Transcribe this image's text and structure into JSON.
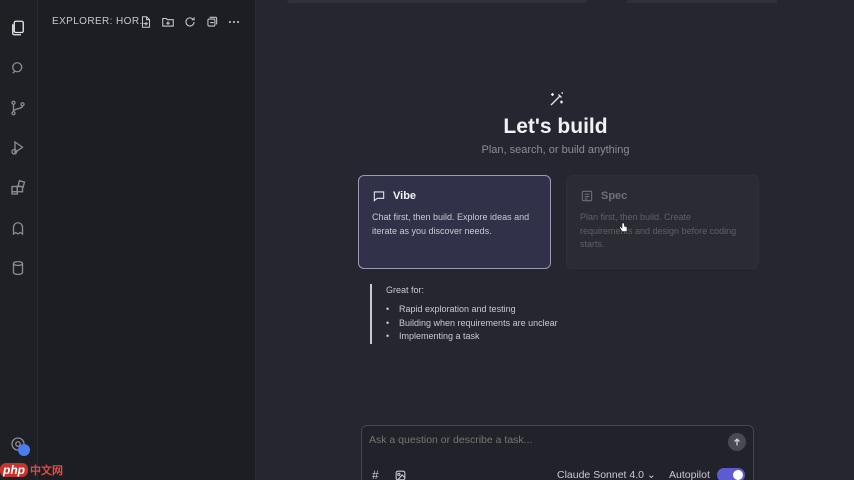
{
  "explorer": {
    "title": "EXPLORER: HOR..."
  },
  "main": {
    "heading": "Let's build",
    "subheading": "Plan, search, or build anything",
    "cards": [
      {
        "title": "Vibe",
        "description": "Chat first, then build. Explore ideas and iterate as you discover needs.",
        "icon": "chat-bubble-icon",
        "selected": true
      },
      {
        "title": "Spec",
        "description": "Plan first, then build. Create requirements and design before coding starts.",
        "icon": "document-icon",
        "selected": false
      }
    ],
    "great_for": {
      "label": "Great for:",
      "items": [
        "Rapid exploration and testing",
        "Building when requirements are unclear",
        "Implementing a task"
      ]
    }
  },
  "chat": {
    "placeholder": "Ask a question or describe a task...",
    "context_symbol": "#",
    "model": "Claude Sonnet 4.0 ⌄",
    "autopilot_label": "Autopilot",
    "autopilot_on": true
  },
  "watermark": {
    "logo": "php",
    "text": "中文网"
  },
  "colors": {
    "accent": "#5c5ccf",
    "selected_card_border": "#9a9ab5",
    "background": "#262630"
  }
}
